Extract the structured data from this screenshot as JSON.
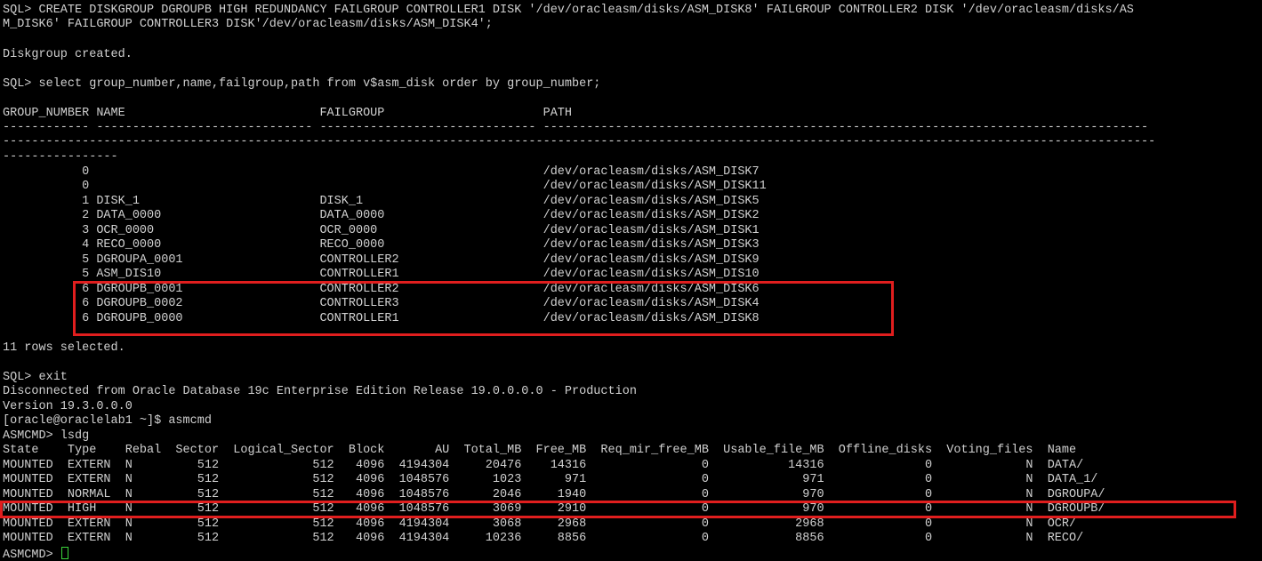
{
  "terminal": {
    "lines": [
      "SQL> CREATE DISKGROUP DGROUPB HIGH REDUNDANCY FAILGROUP CONTROLLER1 DISK '/dev/oracleasm/disks/ASM_DISK8' FAILGROUP CONTROLLER2 DISK '/dev/oracleasm/disks/AS",
      "M_DISK6' FAILGROUP CONTROLLER3 DISK'/dev/oracleasm/disks/ASM_DISK4';",
      "",
      "Diskgroup created.",
      "",
      "SQL> select group_number,name,failgroup,path from v$asm_disk order by group_number;",
      "",
      "GROUP_NUMBER NAME                           FAILGROUP                      PATH",
      "------------ ------------------------------ ------------------------------ ------------------------------------------------------------------------------------",
      "----------------------------------------------------------------------------------------------------------------------------------------------------------------",
      "----------------",
      "           0                                                               /dev/oracleasm/disks/ASM_DISK7",
      "           0                                                               /dev/oracleasm/disks/ASM_DISK11",
      "           1 DISK_1                         DISK_1                         /dev/oracleasm/disks/ASM_DISK5",
      "           2 DATA_0000                      DATA_0000                      /dev/oracleasm/disks/ASM_DISK2",
      "           3 OCR_0000                       OCR_0000                       /dev/oracleasm/disks/ASM_DISK1",
      "           4 RECO_0000                      RECO_0000                      /dev/oracleasm/disks/ASM_DISK3",
      "           5 DGROUPA_0001                   CONTROLLER2                    /dev/oracleasm/disks/ASM_DISK9",
      "           5 ASM_DIS10                      CONTROLLER1                    /dev/oracleasm/disks/ASM_DIS10",
      "           6 DGROUPB_0001                   CONTROLLER2                    /dev/oracleasm/disks/ASM_DISK6",
      "           6 DGROUPB_0002                   CONTROLLER3                    /dev/oracleasm/disks/ASM_DISK4",
      "           6 DGROUPB_0000                   CONTROLLER1                    /dev/oracleasm/disks/ASM_DISK8",
      "",
      "11 rows selected.",
      "",
      "SQL> exit",
      "Disconnected from Oracle Database 19c Enterprise Edition Release 19.0.0.0.0 - Production",
      "Version 19.3.0.0.0",
      "[oracle@oraclelab1 ~]$ asmcmd",
      "ASMCMD> lsdg",
      "State    Type    Rebal  Sector  Logical_Sector  Block       AU  Total_MB  Free_MB  Req_mir_free_MB  Usable_file_MB  Offline_disks  Voting_files  Name",
      "MOUNTED  EXTERN  N         512             512   4096  4194304     20476    14316                0           14316              0             N  DATA/",
      "MOUNTED  EXTERN  N         512             512   4096  1048576      1023      971                0             971              0             N  DATA_1/",
      "MOUNTED  NORMAL  N         512             512   4096  1048576      2046     1940                0             970              0             N  DGROUPA/",
      "MOUNTED  HIGH    N         512             512   4096  1048576      3069     2910                0             970              0             N  DGROUPB/",
      "MOUNTED  EXTERN  N         512             512   4096  4194304      3068     2968                0            2968              0             N  OCR/",
      "MOUNTED  EXTERN  N         512             512   4096  4194304     10236     8856                0            8856              0             N  RECO/",
      "ASMCMD> "
    ],
    "cursor_icon": "block-cursor-icon",
    "colors": {
      "background": "#000000",
      "text": "#d0d0d0",
      "highlight": "#e01e1e",
      "cursor": "#3ad63a"
    }
  }
}
